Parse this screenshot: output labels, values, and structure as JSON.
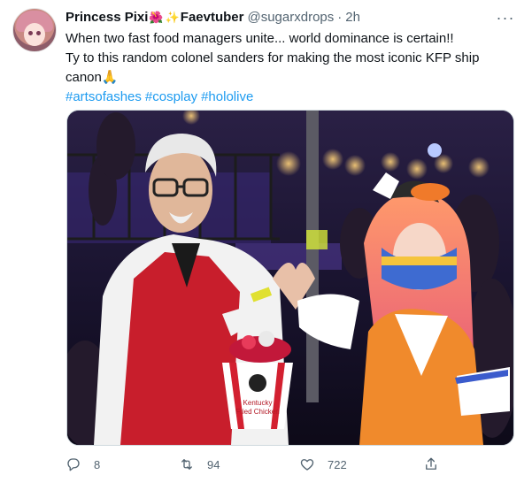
{
  "author": {
    "display_name_1": "Princess Pixi",
    "emoji_1": "🌺",
    "emoji_2": "✨",
    "display_name_2": "Faevtuber",
    "handle": "@sugarxdrops",
    "separator": "·",
    "time": "2h"
  },
  "more_label": "···",
  "tweet": {
    "line1": "When two fast food managers unite... world dominance is certain!!",
    "line2": "Ty to this random colonel sanders for making the most iconic KFP ship canon🙏",
    "hashtags": [
      "#artsofashes",
      "#cosplay",
      "#hololive"
    ]
  },
  "photo": {
    "bucket_text_1": "Kentucky",
    "bucket_text_2": "Fried Chicken"
  },
  "actions": {
    "reply_count": "8",
    "retweet_count": "94",
    "like_count": "722"
  },
  "icons": {
    "reply": "reply-icon",
    "retweet": "retweet-icon",
    "like": "heart-icon",
    "share": "share-icon",
    "more": "more-icon"
  }
}
